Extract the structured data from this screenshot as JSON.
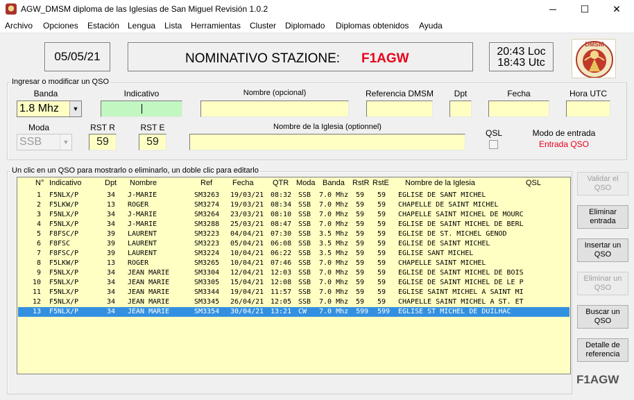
{
  "window": {
    "title": "AGW_DMSM diploma de las Iglesias de San Miguel   Revisión  1.0.2",
    "minimize": "─",
    "maximize": "☐",
    "close": "✕"
  },
  "menu": [
    "Archivo",
    "Opciones",
    "Estación",
    "Lengua",
    "Lista",
    "Herramientas",
    "Cluster",
    "Diplomado",
    "Diplomas obtenidos",
    "Ayuda"
  ],
  "header": {
    "date": "05/05/21",
    "station_label": "NOMINATIVO STAZIONE:",
    "station_call": "F1AGW",
    "time_local": "20:43 Loc",
    "time_utc": "18:43 Utc",
    "logo_text": "DMSM"
  },
  "form": {
    "group_title": "Ingresar o modificar un QSO",
    "labels": {
      "banda": "Banda",
      "indicativo": "Indicativo",
      "nombre": "Nombre (opcional)",
      "referencia": "Referencia DMSM",
      "dpt": "Dpt",
      "fecha": "Fecha",
      "hora": "Hora UTC",
      "moda": "Moda",
      "rst_r": "RST R",
      "rst_e": "RST E",
      "iglesia": "Nombre de la Iglesia (optionnel)",
      "qsl": "QSL",
      "modo_entrada": "Modo de entrada"
    },
    "values": {
      "banda": "1.8 Mhz",
      "indicativo": "",
      "nombre": "",
      "referencia": "",
      "dpt": "",
      "fecha": "",
      "hora": "",
      "moda": "SSB",
      "rst_r": "59",
      "rst_e": "59",
      "iglesia": "",
      "modo_entrada": "Entrada QSO"
    },
    "colors": {
      "modo_entrada": "#e8001a",
      "field_bg": "#ffffc4",
      "active_field_bg": "#c2f7c2"
    }
  },
  "list": {
    "group_title": "Un clic en un QSO para mostrarlo o eliminarlo, un doble clic para editarlo",
    "headers": [
      "N°",
      "Indicativo",
      "Dpt",
      "Nombre",
      "Ref",
      "Fecha",
      "QTR",
      "Moda",
      "Banda",
      "RstR",
      "RstE",
      "Nombre de la Iglesia",
      "QSL"
    ],
    "selected_index": 12,
    "rows": [
      [
        "1",
        "F5NLX/P",
        "34",
        "J-MARIE",
        "SM3263",
        "19/03/21",
        "08:32",
        "SSB",
        "7.0 Mhz",
        "59",
        "59",
        "EGLISE DE SANT MICHEL",
        ""
      ],
      [
        "2",
        "F5LKW/P",
        "13",
        "ROGER",
        "SM3274",
        "19/03/21",
        "08:34",
        "SSB",
        "7.0 Mhz",
        "59",
        "59",
        "CHAPELLE DE SAINT MICHEL",
        ""
      ],
      [
        "3",
        "F5NLX/P",
        "34",
        "J-MARIE",
        "SM3264",
        "23/03/21",
        "08:10",
        "SSB",
        "7.0 Mhz",
        "59",
        "59",
        "CHAPELLE SAINT MICHEL DE MOURC",
        ""
      ],
      [
        "4",
        "F5NLX/P",
        "34",
        "J-MARIE",
        "SM3288",
        "25/03/21",
        "08:47",
        "SSB",
        "7.0 Mhz",
        "59",
        "59",
        "EGLISE DE SAINT MICHEL DE BERL",
        ""
      ],
      [
        "5",
        "F8FSC/P",
        "39",
        "LAURENT",
        "SM3223",
        "04/04/21",
        "07:30",
        "SSB",
        "3.5 Mhz",
        "59",
        "59",
        "EGLISE DE ST. MICHEL GENOD",
        ""
      ],
      [
        "6",
        "F8FSC",
        "39",
        "LAURENT",
        "SM3223",
        "05/04/21",
        "06:08",
        "SSB",
        "3.5 Mhz",
        "59",
        "59",
        "EGLISE DE SAINT MICHEL",
        ""
      ],
      [
        "7",
        "F8FSC/P",
        "39",
        "LAURENT",
        "SM3224",
        "10/04/21",
        "06:22",
        "SSB",
        "3.5 Mhz",
        "59",
        "59",
        "EGLISE SANT MICHEL",
        ""
      ],
      [
        "8",
        "F5LKW/P",
        "13",
        "ROGER",
        "SM3265",
        "10/04/21",
        "07:46",
        "SSB",
        "7.0 Mhz",
        "59",
        "59",
        "CHAPELLE SAINT MICHEL",
        ""
      ],
      [
        "9",
        "F5NLX/P",
        "34",
        "JEAN MARIE",
        "SM3304",
        "12/04/21",
        "12:03",
        "SSB",
        "7.0 Mhz",
        "59",
        "59",
        "EGLISE DE SAINT MICHEL DE BOIS",
        ""
      ],
      [
        "10",
        "F5NLX/P",
        "34",
        "JEAN MARIE",
        "SM3305",
        "15/04/21",
        "12:08",
        "SSB",
        "7.0 Mhz",
        "59",
        "59",
        "EGLISE DE SAINT MICHEL DE LE P",
        ""
      ],
      [
        "11",
        "F5NLX/P",
        "34",
        "JEAN MARIE",
        "SM3344",
        "19/04/21",
        "11:57",
        "SSB",
        "7.0 Mhz",
        "59",
        "59",
        "EGLISE SAINT MICHEL A SAINT MI",
        ""
      ],
      [
        "12",
        "F5NLX/P",
        "34",
        "JEAN MARIE",
        "SM3345",
        "26/04/21",
        "12:05",
        "SSB",
        "7.0 Mhz",
        "59",
        "59",
        "CHAPELLE SAINT MICHEL A ST. ET",
        ""
      ],
      [
        "13",
        "F5NLX/P",
        "34",
        "JEAN MARIE",
        "SM3354",
        "30/04/21",
        "13:21",
        "CW",
        "7.0 Mhz",
        "599",
        "599",
        "EGLISE ST MICHEL DE DUILHAC",
        ""
      ]
    ]
  },
  "buttons": {
    "validar": "Validar el QSO",
    "eliminar_entrada": "Eliminar entrada",
    "insertar": "Insertar un QSO",
    "eliminar_qso": "Eliminar un QSO",
    "buscar": "Buscar un QSO",
    "detalle": "Detalle de referencia"
  },
  "brand": "F1AGW"
}
